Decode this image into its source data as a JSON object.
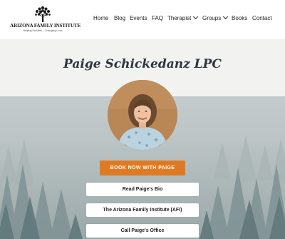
{
  "logo": {
    "name": "ARIZONA FAMILY INSTITUTE",
    "tagline": "Helping Families... Changing Lives",
    "icon": "tree-icon"
  },
  "nav": {
    "home": "Home",
    "blog": "Blog",
    "events": "Events",
    "faq": "FAQ",
    "therapist": "Therapist",
    "groups": "Groups",
    "books": "Books",
    "contact": "Contact"
  },
  "page": {
    "title": "Paige Schickedanz LPC"
  },
  "buttons": {
    "book": "BOOK NOW WITH PAIGE",
    "bio": "Read Paige's Bio",
    "afi": "The Arizona Family Institute (AFI)",
    "office": "Call Paige's Office"
  },
  "colors": {
    "accent": "#e07a22",
    "title_text": "#2f3540",
    "band": "#f2f2f1"
  }
}
